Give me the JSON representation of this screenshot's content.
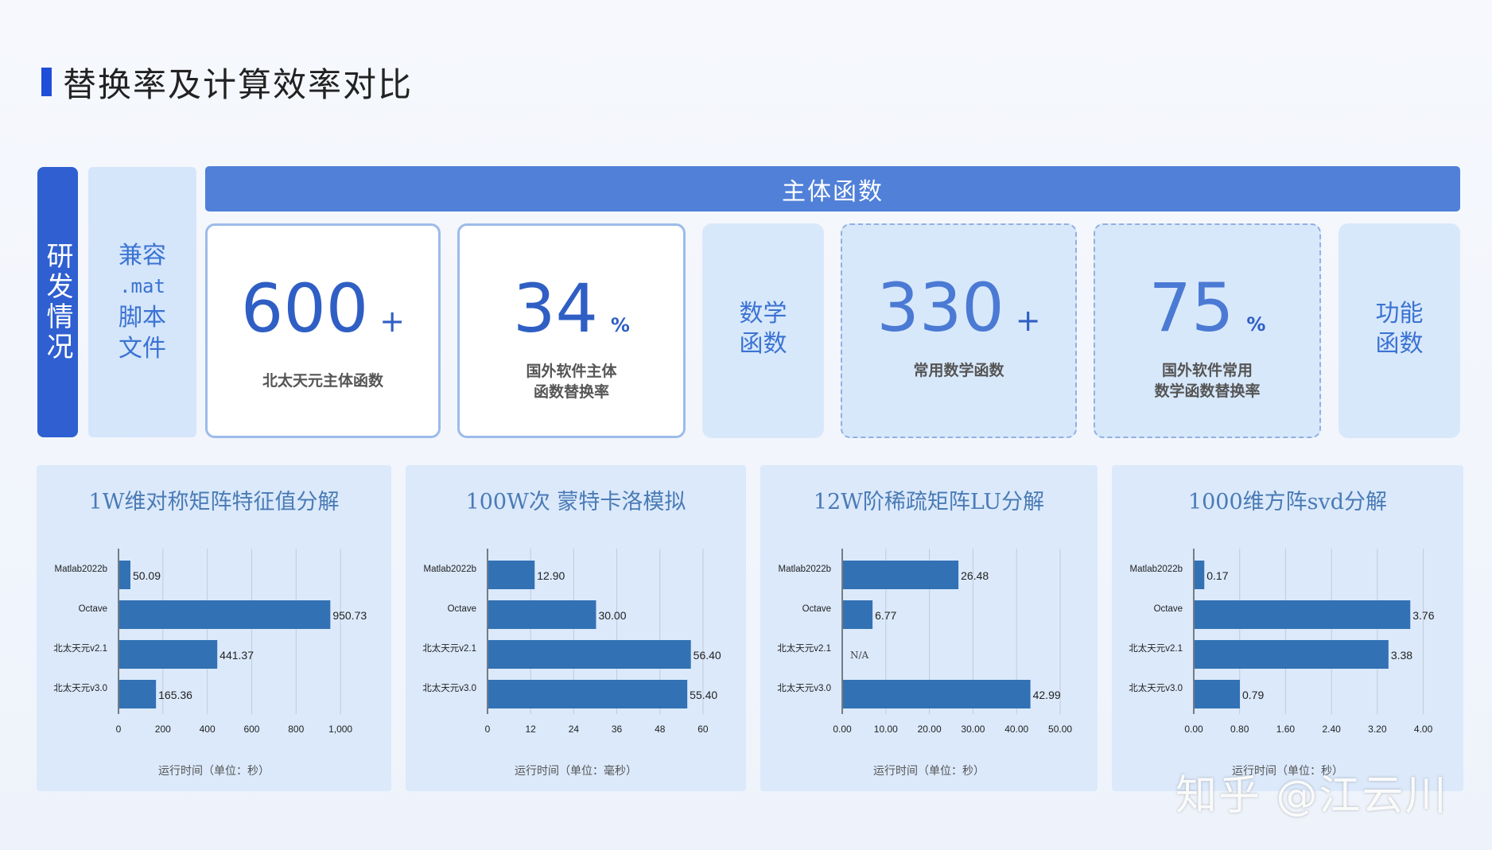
{
  "title": "替换率及计算效率对比",
  "left_tag": "研发情况",
  "compat": {
    "line1": "兼容",
    "line2": ".mat",
    "line3": "脚本",
    "line4": "文件"
  },
  "header": "主体函数",
  "cards": [
    {
      "value": "600",
      "suffix": "+",
      "caption_l1": "北太天元主体函数",
      "caption_l2": ""
    },
    {
      "value": "34",
      "suffix": "%",
      "caption_l1": "国外软件主体",
      "caption_l2": "函数替换率"
    },
    {
      "value": "330",
      "suffix": "+",
      "caption_l1": "常用数学函数",
      "caption_l2": ""
    },
    {
      "value": "75",
      "suffix": "%",
      "caption_l1": "国外软件常用",
      "caption_l2": "数学函数替换率"
    }
  ],
  "labels": {
    "math_l1": "数学",
    "math_l2": "函数",
    "func_l1": "功能",
    "func_l2": "函数"
  },
  "chart_data": [
    {
      "type": "bar",
      "orientation": "horizontal",
      "title": "1W维对称矩阵特征值分解",
      "categories": [
        "Matlab2022b",
        "Octave",
        "北太天元v2.1",
        "北太天元v3.0"
      ],
      "values": [
        50.09,
        950.73,
        441.37,
        165.36
      ],
      "value_labels": [
        "50.09",
        "950.73",
        "441.37",
        "165.36"
      ],
      "xlim": [
        0,
        1100
      ],
      "xticks": [
        0,
        200,
        400,
        600,
        800,
        1000
      ],
      "xtick_labels": [
        "0",
        "200",
        "400",
        "600",
        "800",
        "1,000"
      ],
      "xlabel": "运行时间（单位：秒）",
      "grid": true,
      "color": "#3271b4"
    },
    {
      "type": "bar",
      "orientation": "horizontal",
      "title": "100W次  蒙特卡洛模拟",
      "categories": [
        "Matlab2022b",
        "Octave",
        "北太天元v2.1",
        "北太天元v3.0"
      ],
      "values": [
        12.9,
        30.0,
        56.4,
        55.4
      ],
      "value_labels": [
        "12.90",
        "30.00",
        "56.40",
        "55.40"
      ],
      "xlim": [
        0,
        64
      ],
      "xticks": [
        0,
        12,
        24,
        36,
        48,
        60
      ],
      "xtick_labels": [
        "0",
        "12",
        "24",
        "36",
        "48",
        "60"
      ],
      "xlabel": "运行时间（单位：毫秒）",
      "grid": true,
      "color": "#3271b4"
    },
    {
      "type": "bar",
      "orientation": "horizontal",
      "title": "12W阶稀疏矩阵LU分解",
      "categories": [
        "Matlab2022b",
        "Octave",
        "北太天元v2.1",
        "北太天元v3.0"
      ],
      "values": [
        26.48,
        6.77,
        null,
        42.99
      ],
      "value_labels": [
        "26.48",
        "6.77",
        "N/A",
        "42.99"
      ],
      "xlim": [
        0,
        52
      ],
      "xticks": [
        0,
        10,
        20,
        30,
        40,
        50
      ],
      "xtick_labels": [
        "0.00",
        "10.00",
        "20.00",
        "30.00",
        "40.00",
        "50.00"
      ],
      "xlabel": "运行时间（单位：秒）",
      "grid": true,
      "color": "#3271b4"
    },
    {
      "type": "bar",
      "orientation": "horizontal",
      "title": "1000维方阵svd分解",
      "categories": [
        "Matlab2022b",
        "Octave",
        "北太天元v2.1",
        "北太天元v3.0"
      ],
      "values": [
        0.17,
        3.76,
        3.38,
        0.79
      ],
      "value_labels": [
        "0.17",
        "3.76",
        "3.38",
        "0.79"
      ],
      "xlim": [
        0,
        4.2
      ],
      "xticks": [
        0,
        0.8,
        1.6,
        2.4,
        3.2,
        4.0
      ],
      "xtick_labels": [
        "0.00",
        "0.80",
        "1.60",
        "2.40",
        "3.20",
        "4.00"
      ],
      "xlabel": "运行时间（单位：秒）",
      "grid": true,
      "color": "#3271b4"
    }
  ],
  "watermark": "知乎 @江云川"
}
